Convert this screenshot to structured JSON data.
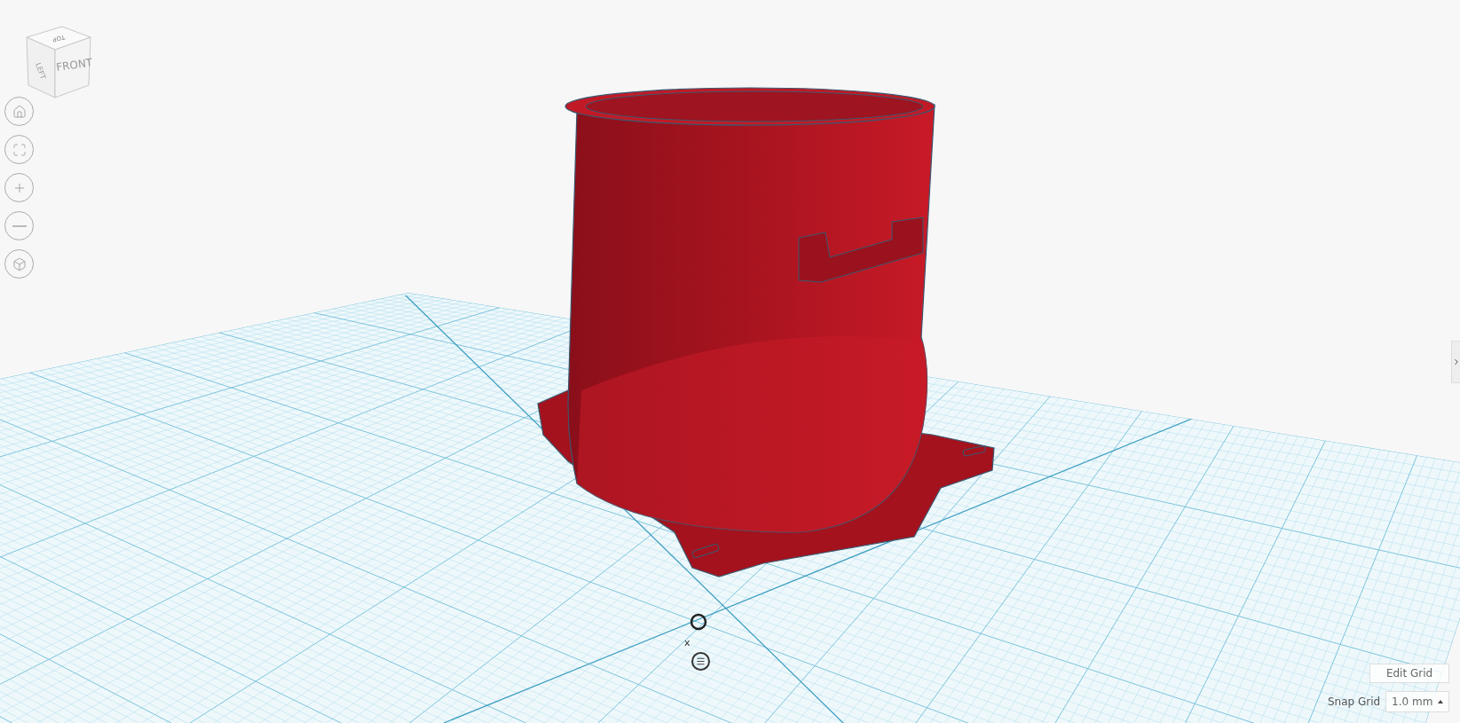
{
  "view_cube": {
    "top": "TOP",
    "left": "LEFT",
    "front": "FRONT"
  },
  "origin": {
    "axis_label": "x"
  },
  "grid": {
    "edit_button": "Edit Grid",
    "snap_label": "Snap Grid",
    "snap_value": "1.0 mm"
  }
}
